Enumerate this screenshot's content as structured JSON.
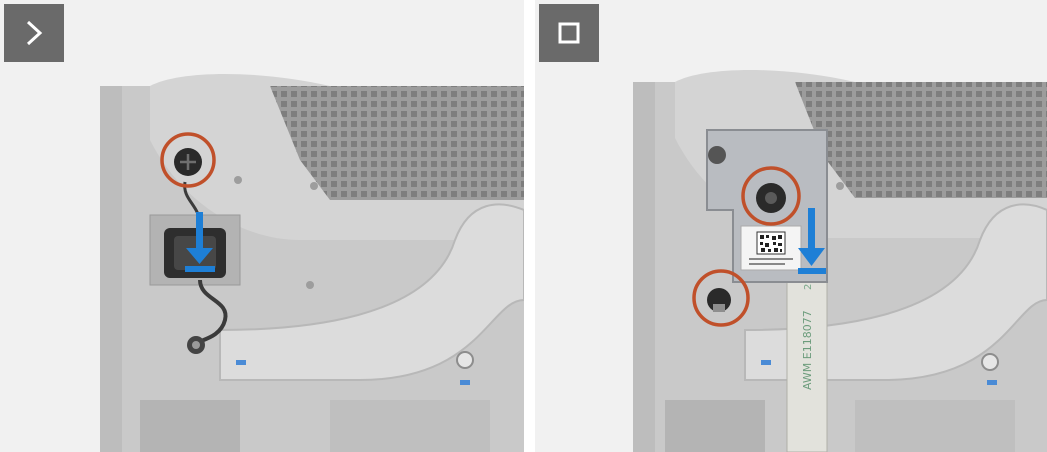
{
  "panels": [
    {
      "step_icon": "chevron-right-icon",
      "description_icon": "arrow-down-icon"
    },
    {
      "step_icon": "stop-square-icon",
      "label_text": "AWM E118077",
      "label_text_2": "2070"
    }
  ],
  "colors": {
    "badge": "#6a6a6a",
    "callout_ring": "#c0502a",
    "arrow": "#1e7fd6",
    "chassis": "#c8c8c8",
    "chassis_dark": "#9a9a9a",
    "mesh": "#8e8e8e"
  }
}
